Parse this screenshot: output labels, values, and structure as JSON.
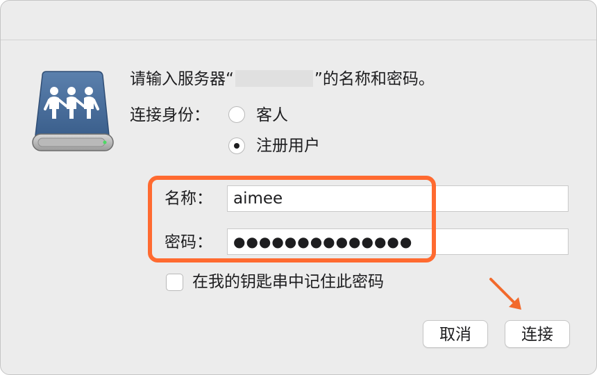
{
  "dialog": {
    "prompt_before": "请输入服务器“",
    "prompt_after": "”的名称和密码。",
    "connect_as_label": "连接身份：",
    "options": [
      {
        "label": "客人",
        "selected": false
      },
      {
        "label": "注册用户",
        "selected": true
      }
    ],
    "name_label": "名称：",
    "name_value": "aimee",
    "password_label": "密码：",
    "password_value": "●●●●●●●●●●●●●●",
    "remember_label": "在我的钥匙串中记住此密码",
    "remember_checked": false,
    "cancel_label": "取消",
    "connect_label": "连接"
  },
  "colors": {
    "highlight": "#ff6a30",
    "arrow": "#f26a2c",
    "icon_body": "#4a6e9c"
  },
  "icons": {
    "server": "shared-server-icon",
    "arrow": "annotation-arrow"
  }
}
